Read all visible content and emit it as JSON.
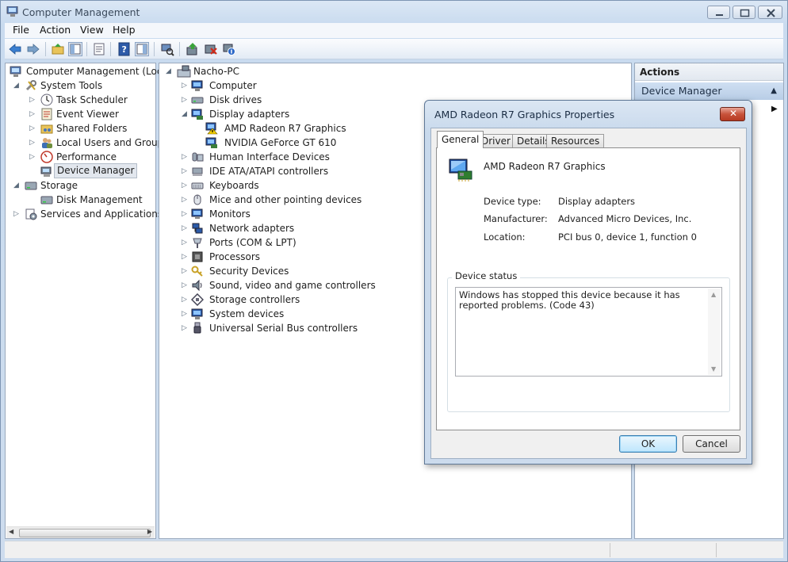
{
  "window": {
    "title": "Computer Management"
  },
  "menu": [
    "File",
    "Action",
    "View",
    "Help"
  ],
  "toolbar_icons": [
    "back-icon",
    "forward-icon",
    "up-folder-icon",
    "show-hide-tree-icon",
    "properties-icon",
    "help-icon",
    "show-hide-action-pane-icon",
    "scan-hardware-icon",
    "update-driver-icon",
    "uninstall-icon",
    "disable-icon"
  ],
  "left_tree": {
    "root": "Computer Management (Local",
    "items": [
      {
        "label": "System Tools"
      },
      {
        "label": "Task Scheduler"
      },
      {
        "label": "Event Viewer"
      },
      {
        "label": "Shared Folders"
      },
      {
        "label": "Local Users and Groups"
      },
      {
        "label": "Performance"
      },
      {
        "label": "Device Manager"
      },
      {
        "label": "Storage"
      },
      {
        "label": "Disk Management"
      },
      {
        "label": "Services and Applications"
      }
    ]
  },
  "device_tree": {
    "root": "Nacho-PC",
    "items": [
      {
        "label": "Computer"
      },
      {
        "label": "Disk drives"
      },
      {
        "label": "Display adapters"
      },
      {
        "label": "AMD Radeon R7 Graphics"
      },
      {
        "label": "NVIDIA GeForce GT 610"
      },
      {
        "label": "Human Interface Devices"
      },
      {
        "label": "IDE ATA/ATAPI controllers"
      },
      {
        "label": "Keyboards"
      },
      {
        "label": "Mice and other pointing devices"
      },
      {
        "label": "Monitors"
      },
      {
        "label": "Network adapters"
      },
      {
        "label": "Ports (COM & LPT)"
      },
      {
        "label": "Processors"
      },
      {
        "label": "Security Devices"
      },
      {
        "label": "Sound, video and game controllers"
      },
      {
        "label": "Storage controllers"
      },
      {
        "label": "System devices"
      },
      {
        "label": "Universal Serial Bus controllers"
      }
    ]
  },
  "actions": {
    "header": "Actions",
    "section": "Device Manager"
  },
  "dialog": {
    "title": "AMD Radeon R7 Graphics Properties",
    "tabs": [
      "General",
      "Driver",
      "Details",
      "Resources"
    ],
    "device_name": "AMD Radeon R7 Graphics",
    "props": [
      {
        "key": "Device type:",
        "value": "Display adapters"
      },
      {
        "key": "Manufacturer:",
        "value": "Advanced Micro Devices, Inc."
      },
      {
        "key": "Location:",
        "value": "PCI bus 0, device 1, function 0"
      }
    ],
    "status_label": "Device status",
    "status_text": "Windows has stopped this device because it has reported problems. (Code 43)",
    "ok": "OK",
    "cancel": "Cancel"
  }
}
